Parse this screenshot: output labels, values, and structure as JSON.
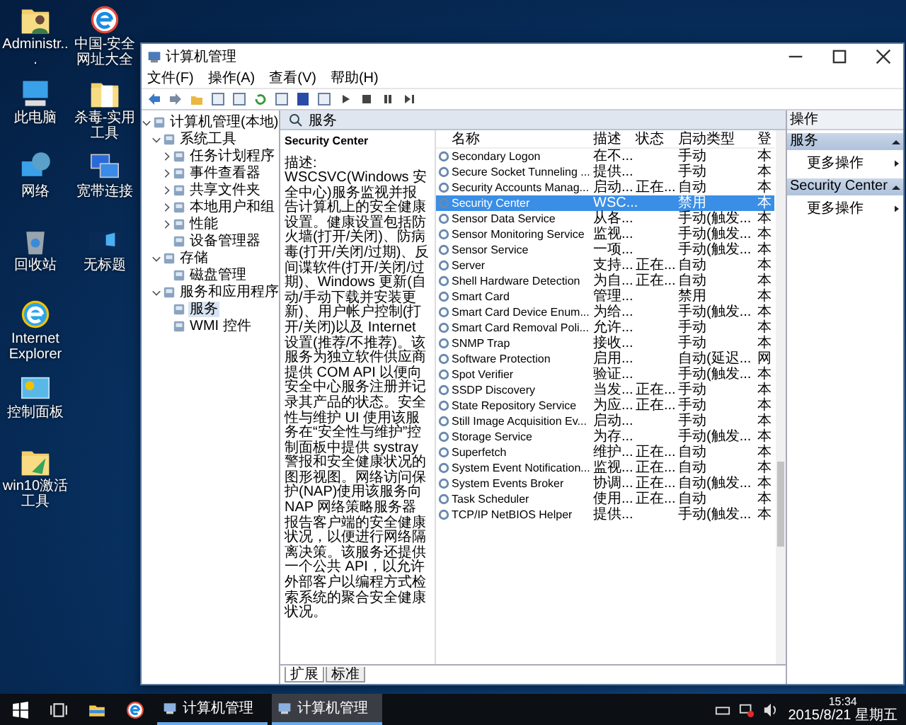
{
  "desktop_icons": [
    {
      "label": "Administr...",
      "kind": "userfolder"
    },
    {
      "label": "此电脑",
      "kind": "computer"
    },
    {
      "label": "网络",
      "kind": "network"
    },
    {
      "label": "回收站",
      "kind": "bin"
    },
    {
      "label": "Internet Explorer",
      "kind": "ie"
    },
    {
      "label": "控制面板",
      "kind": "panel"
    },
    {
      "label": "win10激活工具",
      "kind": "toolfolder"
    },
    {
      "label": "中国-安全网址大全",
      "kind": "browser"
    },
    {
      "label": "杀毒-实用工具",
      "kind": "folder"
    },
    {
      "label": "宽带连接",
      "kind": "netpc"
    },
    {
      "label": "无标题",
      "kind": "image"
    }
  ],
  "window": {
    "title": "计算机管理",
    "menu": [
      "文件(F)",
      "操作(A)",
      "查看(V)",
      "帮助(H)"
    ],
    "tree": [
      {
        "label": "计算机管理(本地)",
        "expanded": true,
        "selected": false,
        "children": [
          {
            "label": "系统工具",
            "expanded": true,
            "selected": false,
            "children": [
              {
                "label": "任务计划程序",
                "expanded": false,
                "selected": false
              },
              {
                "label": "事件查看器",
                "expanded": false,
                "selected": false
              },
              {
                "label": "共享文件夹",
                "expanded": false,
                "selected": false
              },
              {
                "label": "本地用户和组",
                "expanded": false,
                "selected": false
              },
              {
                "label": "性能",
                "expanded": false,
                "selected": false
              },
              {
                "label": "设备管理器",
                "selected": false
              }
            ]
          },
          {
            "label": "存储",
            "expanded": true,
            "selected": false,
            "children": [
              {
                "label": "磁盘管理",
                "selected": false
              }
            ]
          },
          {
            "label": "服务和应用程序",
            "expanded": true,
            "selected": false,
            "children": [
              {
                "label": "服务",
                "selected": true
              },
              {
                "label": "WMI 控件",
                "selected": false
              }
            ]
          }
        ]
      }
    ],
    "pane_header": "服务",
    "detail": {
      "title": "Security Center",
      "label": "描述:",
      "text": "WSCSVC(Windows 安全中心)服务监视并报告计算机上的安全健康设置。健康设置包括防火墙(打开/关闭)、防病毒(打开/关闭/过期)、反间谍软件(打开/关闭/过期)、Windows 更新(自动/手动下载并安装更新)、用户帐户控制(打开/关闭)以及 Internet 设置(推荐/不推荐)。该服务为独立软件供应商提供 COM API 以便向安全中心服务注册并记录其产品的状态。安全性与维护 UI 使用该服务在“安全性与维护”控制面板中提供 systray 警报和安全健康状况的图形视图。网络访问保护(NAP)使用该服务向 NAP 网络策略服务器报告客户端的安全健康状况，以便进行网络隔离决策。该服务还提供一个公共 API，以允许外部客户以编程方式检索系统的聚合安全健康状况。"
    },
    "columns": [
      "名称",
      "描述",
      "状态",
      "启动类型",
      "登"
    ],
    "services": [
      {
        "name": "Secondary Logon",
        "desc": "在不...",
        "startup": "手动",
        "logon": "本",
        "selected": false
      },
      {
        "name": "Secure Socket Tunneling ...",
        "desc": "提供...",
        "startup": "手动",
        "logon": "本",
        "selected": false
      },
      {
        "name": "Security Accounts Manag...",
        "desc": "启动...",
        "status": "正在...",
        "startup": "自动",
        "logon": "本",
        "selected": false
      },
      {
        "name": "Security Center",
        "desc": "WSC...",
        "startup": "禁用",
        "logon": "本",
        "selected": true
      },
      {
        "name": "Sensor Data Service",
        "desc": "从各...",
        "startup": "手动(触发...",
        "logon": "本",
        "selected": false
      },
      {
        "name": "Sensor Monitoring Service",
        "desc": "监视...",
        "startup": "手动(触发...",
        "logon": "本",
        "selected": false
      },
      {
        "name": "Sensor Service",
        "desc": "一项...",
        "startup": "手动(触发...",
        "logon": "本",
        "selected": false
      },
      {
        "name": "Server",
        "desc": "支持...",
        "status": "正在...",
        "startup": "自动",
        "logon": "本",
        "selected": false
      },
      {
        "name": "Shell Hardware Detection",
        "desc": "为自...",
        "status": "正在...",
        "startup": "自动",
        "logon": "本",
        "selected": false
      },
      {
        "name": "Smart Card",
        "desc": "管理...",
        "startup": "禁用",
        "logon": "本",
        "selected": false
      },
      {
        "name": "Smart Card Device Enum...",
        "desc": "为给...",
        "startup": "手动(触发...",
        "logon": "本",
        "selected": false
      },
      {
        "name": "Smart Card Removal Poli...",
        "desc": "允许...",
        "startup": "手动",
        "logon": "本",
        "selected": false
      },
      {
        "name": "SNMP Trap",
        "desc": "接收...",
        "startup": "手动",
        "logon": "本",
        "selected": false
      },
      {
        "name": "Software Protection",
        "desc": "启用...",
        "startup": "自动(延迟...",
        "logon": "网",
        "selected": false
      },
      {
        "name": "Spot Verifier",
        "desc": "验证...",
        "startup": "手动(触发...",
        "logon": "本",
        "selected": false
      },
      {
        "name": "SSDP Discovery",
        "desc": "当发...",
        "status": "正在...",
        "startup": "手动",
        "logon": "本",
        "selected": false
      },
      {
        "name": "State Repository Service",
        "desc": "为应...",
        "status": "正在...",
        "startup": "手动",
        "logon": "本",
        "selected": false
      },
      {
        "name": "Still Image Acquisition Ev...",
        "desc": "启动...",
        "startup": "手动",
        "logon": "本",
        "selected": false
      },
      {
        "name": "Storage Service",
        "desc": "为存...",
        "startup": "手动(触发...",
        "logon": "本",
        "selected": false
      },
      {
        "name": "Superfetch",
        "desc": "维护...",
        "status": "正在...",
        "startup": "自动",
        "logon": "本",
        "selected": false
      },
      {
        "name": "System Event Notification...",
        "desc": "监视...",
        "status": "正在...",
        "startup": "自动",
        "logon": "本",
        "selected": false
      },
      {
        "name": "System Events Broker",
        "desc": "协调...",
        "status": "正在...",
        "startup": "自动(触发...",
        "logon": "本",
        "selected": false
      },
      {
        "name": "Task Scheduler",
        "desc": "使用...",
        "status": "正在...",
        "startup": "自动",
        "logon": "本",
        "selected": false
      },
      {
        "name": "TCP/IP NetBIOS Helper",
        "desc": "提供...",
        "startup": "手动(触发...",
        "logon": "本",
        "selected": false
      }
    ],
    "actions": {
      "title": "操作",
      "sections": [
        {
          "title": "服务",
          "items": [
            "更多操作"
          ]
        },
        {
          "title": "Security Center",
          "items": [
            "更多操作"
          ]
        }
      ]
    },
    "tabs": [
      {
        "label": "扩展",
        "selected": true
      },
      {
        "label": "标准",
        "selected": false
      }
    ]
  },
  "taskbar": {
    "apps": [
      {
        "label": "计算机管理",
        "selected": false
      },
      {
        "label": "计算机管理",
        "selected": true
      }
    ],
    "time": "15:34",
    "date": "2015/8/21 星期五"
  }
}
